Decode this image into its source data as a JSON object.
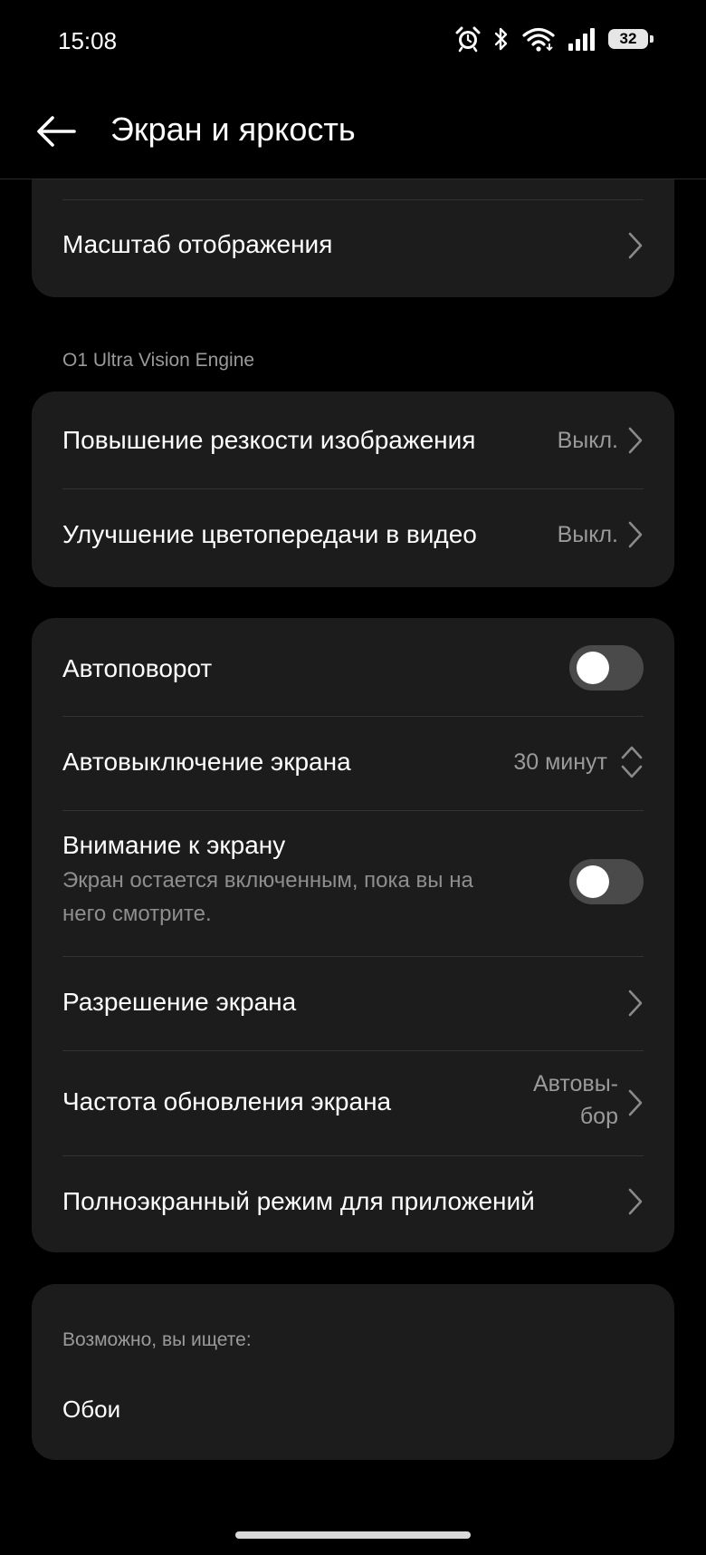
{
  "status_bar": {
    "time": "15:08",
    "battery": "32",
    "icons": [
      "alarm-icon",
      "bluetooth-icon",
      "wifi-icon",
      "signal-icon",
      "battery-icon"
    ]
  },
  "header": {
    "title": "Экран и яркость",
    "back_icon": "arrow-left-icon"
  },
  "display_card": {
    "items": [
      {
        "label": "Масштаб отображения"
      }
    ]
  },
  "vision_section": {
    "header": "O1 Ultra Vision Engine",
    "items": [
      {
        "label": "Повышение резкости изображения",
        "value": "Выкл."
      },
      {
        "label": "Улучшение цветопередачи в видео",
        "value": "Выкл."
      }
    ]
  },
  "settings_card": {
    "auto_rotate": {
      "label": "Автоповорот",
      "enabled": false
    },
    "screen_timeout": {
      "label": "Автовыключение экрана",
      "value": "30 минут"
    },
    "screen_attention": {
      "label": "Внимание к экрану",
      "description_line1": "Экран остается включенным, пока вы на",
      "description_line2": "него смотрите.",
      "enabled": false
    },
    "resolution": {
      "label": "Разрешение экрана"
    },
    "refresh_rate": {
      "label": "Частота обновления экрана",
      "value_line1": "Автовы-",
      "value_line2": "бор"
    },
    "fullscreen_apps": {
      "label": "Полноэкранный режим для приложений"
    }
  },
  "suggestions": {
    "header": "Возможно, вы ищете:",
    "items": [
      {
        "label": "Обои"
      }
    ]
  },
  "colors": {
    "background": "#000000",
    "card": "#1c1c1c",
    "secondary_text": "#9a9a9a",
    "toggle_off": "#4a4a4a"
  }
}
